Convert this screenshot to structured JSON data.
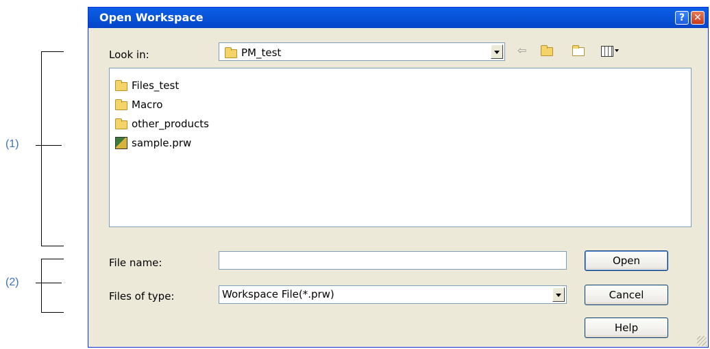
{
  "annotations": {
    "label_1": "(1)",
    "label_2": "(2)"
  },
  "dialog": {
    "title": "Open Workspace",
    "help_glyph": "?",
    "close_glyph": "✕"
  },
  "look_in": {
    "label": "Look in:",
    "value": "PM_test"
  },
  "toolbar": {
    "back_icon": "back-arrow-icon",
    "up_icon": "up-folder-icon",
    "new_folder_icon": "new-folder-icon",
    "view_menu_icon": "view-menu-icon"
  },
  "files": [
    {
      "name": "Files_test",
      "type": "folder"
    },
    {
      "name": "Macro",
      "type": "folder"
    },
    {
      "name": "other_products",
      "type": "folder"
    },
    {
      "name": "sample.prw",
      "type": "workspace-file"
    }
  ],
  "file_name": {
    "label": "File name:",
    "value": ""
  },
  "file_type": {
    "label": "Files of type:",
    "value": "Workspace File(*.prw)"
  },
  "buttons": {
    "open": "Open",
    "cancel": "Cancel",
    "help": "Help"
  }
}
